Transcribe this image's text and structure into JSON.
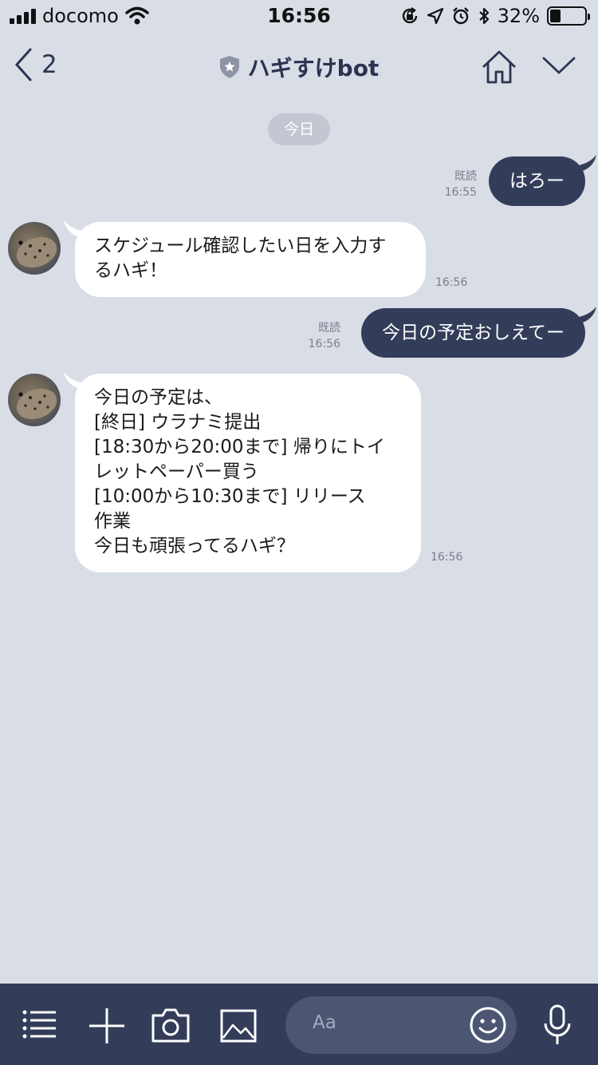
{
  "status_bar": {
    "carrier": "docomo",
    "time": "16:56",
    "battery_percent": "32%",
    "battery_level": 0.32
  },
  "header": {
    "back_count": "2",
    "title": "ハギすけbot"
  },
  "date_label": "今日",
  "messages": [
    {
      "direction": "out",
      "text": "はろー",
      "read": "既読",
      "time": "16:55"
    },
    {
      "direction": "in",
      "text": "スケジュール確認したい日を入力す\nるハギ！",
      "time": "16:56"
    },
    {
      "direction": "out",
      "text": "今日の予定おしえてー",
      "read": "既読",
      "time": "16:56"
    },
    {
      "direction": "in",
      "text": "今日の予定は、\n[終日] ウラナミ提出\n[18:30から20:00まで] 帰りにトイ\nレットペーパー買う\n[10:00から10:30まで] リリース\n作業\n今日も頑張ってるハギ？",
      "time": "16:56"
    }
  ],
  "input": {
    "placeholder": "Aa"
  },
  "icons": {
    "back": "chevron-left-icon",
    "official": "shield-star-icon",
    "home": "home-icon",
    "menu_toggle": "chevron-down-icon",
    "menu": "list-icon",
    "add": "plus-icon",
    "camera": "camera-icon",
    "image": "image-icon",
    "emoji": "smiley-icon",
    "mic": "microphone-icon"
  },
  "colors": {
    "background": "#d9dde6",
    "accent": "#333d5a",
    "bubble_in": "#ffffff"
  }
}
